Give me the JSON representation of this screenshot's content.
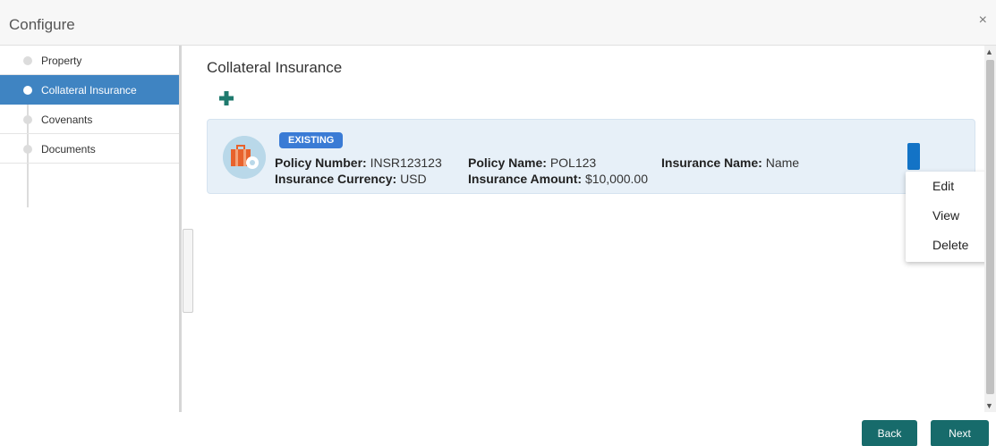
{
  "header": {
    "title": "Configure",
    "close_symbol": "×"
  },
  "sidebar": {
    "items": [
      {
        "label": "Property",
        "active": false
      },
      {
        "label": "Collateral Insurance",
        "active": true
      },
      {
        "label": "Covenants",
        "active": false
      },
      {
        "label": "Documents",
        "active": false
      }
    ]
  },
  "main": {
    "title": "Collateral Insurance",
    "add_icon": "plus-icon",
    "card": {
      "icon": "briefcase-gear-icon",
      "badge": "EXISTING",
      "policy_number_label": "Policy Number:",
      "policy_number_value": "INSR123123",
      "policy_name_label": "Policy Name:",
      "policy_name_value": "POL123",
      "insurance_name_label": "Insurance Name:",
      "insurance_name_value": "Name",
      "insurance_currency_label": "Insurance Currency:",
      "insurance_currency_value": "USD",
      "insurance_amount_label": "Insurance Amount:",
      "insurance_amount_value": "$10,000.00"
    }
  },
  "context_menu": {
    "items": [
      "Edit",
      "View",
      "Delete"
    ]
  },
  "footer": {
    "back_label": "Back",
    "next_label": "Next"
  },
  "colors": {
    "accent": "#3f84c2",
    "button": "#176b6b",
    "badge": "#3a7bd5",
    "card_bg": "#e7f0f8",
    "kebab": "#1373c6",
    "plus": "#1f7a6e"
  }
}
